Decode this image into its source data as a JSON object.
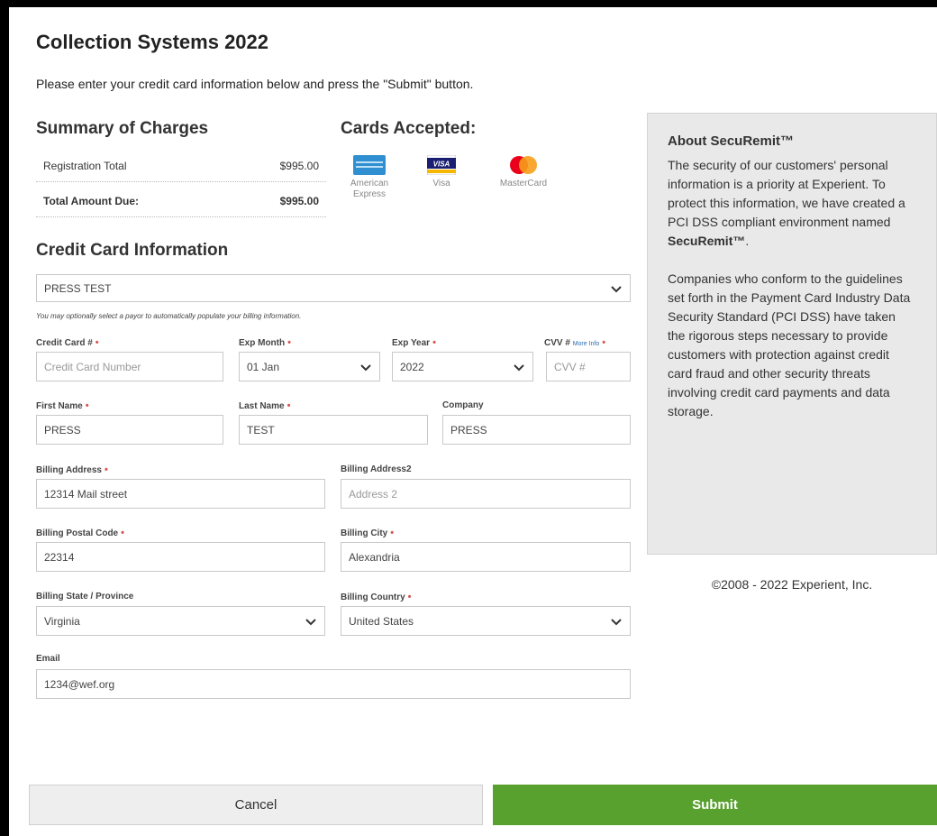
{
  "page": {
    "title": "Collection Systems 2022",
    "intro": "Please enter your credit card information below and press the \"Submit\" button."
  },
  "summary": {
    "heading": "Summary of Charges",
    "rows": [
      {
        "label": "Registration Total",
        "value": "$995.00"
      },
      {
        "label": "Total Amount Due:",
        "value": "$995.00"
      }
    ]
  },
  "cards": {
    "heading": "Cards Accepted:",
    "items": [
      {
        "name": "American Express",
        "icon": "amex-card-icon"
      },
      {
        "name": "Visa",
        "icon": "visa-card-icon"
      },
      {
        "name": "MasterCard",
        "icon": "mastercard-card-icon"
      }
    ],
    "colors": {
      "amex": "#2f8fd0",
      "visa": "#1a1f71",
      "mc_red": "#eb001b",
      "mc_orange": "#f79e1b"
    }
  },
  "credit_card_info": {
    "heading": "Credit Card Information",
    "payor": {
      "value": "PRESS TEST"
    },
    "payor_hint": "You may optionally select a payor to automatically populate your billing information."
  },
  "fields": {
    "card_number": {
      "label": "Credit Card #",
      "placeholder": "Credit Card Number"
    },
    "exp_month": {
      "label": "Exp Month",
      "value": "01 Jan"
    },
    "exp_year": {
      "label": "Exp Year",
      "value": "2022"
    },
    "cvv": {
      "label": "CVV #",
      "more": "More Info",
      "placeholder": "CVV #"
    },
    "first_name": {
      "label": "First Name",
      "value": "PRESS"
    },
    "last_name": {
      "label": "Last Name",
      "value": "TEST"
    },
    "company": {
      "label": "Company",
      "value": "PRESS"
    },
    "address1": {
      "label": "Billing Address",
      "value": "12314 Mail street"
    },
    "address2": {
      "label": "Billing Address2",
      "placeholder": "Address 2"
    },
    "postal": {
      "label": "Billing Postal Code",
      "value": "22314"
    },
    "city": {
      "label": "Billing City",
      "value": "Alexandria"
    },
    "state": {
      "label": "Billing State / Province",
      "value": "Virginia"
    },
    "country": {
      "label": "Billing Country",
      "value": "United States"
    },
    "email": {
      "label": "Email",
      "value": "1234@wef.org"
    }
  },
  "about": {
    "heading": "About SecuRemit™",
    "para1": "The security of our customers' personal information is a priority at Experient. To protect this information, we have created a PCI DSS compliant environment named",
    "para1_bold": "SecuRemit™",
    "para2": "Companies who conform to the guidelines set forth in the Payment Card Industry Data Security Standard (PCI DSS) have taken the rigorous steps necessary to provide customers with protection against credit card fraud and other security threats involving credit card payments and data storage."
  },
  "footer": {
    "copyright": "©2008 - 2022 Experient, Inc.",
    "cancel_label": "Cancel",
    "submit_label": "Submit",
    "submit_color": "#58a12e",
    "required_color": "#d9534f"
  }
}
